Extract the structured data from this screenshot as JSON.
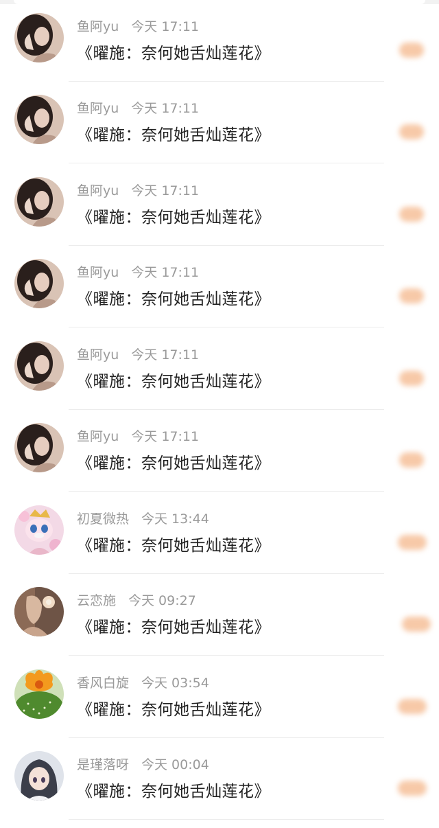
{
  "messages": [
    {
      "name": "鱼阿yu",
      "time": "今天 17:11",
      "title": "《曜施：奈何她舌灿莲花》",
      "avatar": "portrait-woman-icon"
    },
    {
      "name": "鱼阿yu",
      "time": "今天 17:11",
      "title": "《曜施：奈何她舌灿莲花》",
      "avatar": "portrait-woman-icon"
    },
    {
      "name": "鱼阿yu",
      "time": "今天 17:11",
      "title": "《曜施：奈何她舌灿莲花》",
      "avatar": "portrait-woman-icon"
    },
    {
      "name": "鱼阿yu",
      "time": "今天 17:11",
      "title": "《曜施：奈何她舌灿莲花》",
      "avatar": "portrait-woman-icon"
    },
    {
      "name": "鱼阿yu",
      "time": "今天 17:11",
      "title": "《曜施：奈何她舌灿莲花》",
      "avatar": "portrait-woman-icon"
    },
    {
      "name": "鱼阿yu",
      "time": "今天 17:11",
      "title": "《曜施：奈何她舌灿莲花》",
      "avatar": "portrait-woman-icon"
    },
    {
      "name": "初夏微热",
      "time": "今天 13:44",
      "title": "《曜施：奈何她舌灿莲花》",
      "avatar": "plush-fox-icon"
    },
    {
      "name": "云恋施",
      "time": "今天 09:27",
      "title": "《曜施：奈何她舌灿莲花》",
      "avatar": "illustration-girl-icon"
    },
    {
      "name": "香风白旋",
      "time": "今天 03:54",
      "title": "《曜施：奈何她舌灿莲花》",
      "avatar": "cactus-flower-icon"
    },
    {
      "name": "是瑾落呀",
      "time": "今天 00:04",
      "title": "《曜施：奈何她舌灿莲花》",
      "avatar": "anime-girl-icon"
    }
  ],
  "colors": {
    "name_text": "#9a9a9a",
    "title_text": "#222222",
    "badge": "#f7c9a8",
    "divider": "#ececec"
  }
}
